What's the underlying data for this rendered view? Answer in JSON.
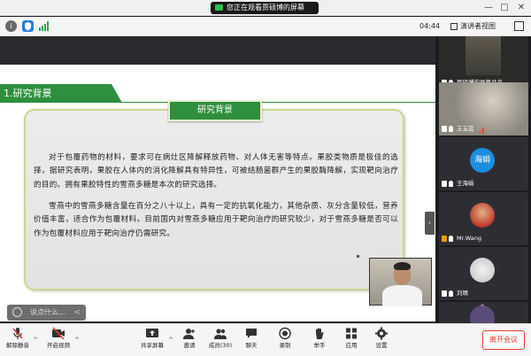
{
  "window": {
    "sharing_notice": "您正在观看贾硕博的屏幕",
    "controls": [
      "—",
      "□",
      "✕"
    ]
  },
  "infobar": {
    "info_icon": "i",
    "timer": "04:44",
    "view_label": "演讲者视图"
  },
  "slide": {
    "section_title": "1.研究背景",
    "box_title": "研究背景",
    "paragraphs": [
      "对于包覆药物的材料，要求可在病灶区降解释放药物、对人体无害等特点。果胶类物质是极佳的选择，据研究表明，果胶在人体内的消化降解具有特异性，可被结肠菌群产生的果胶酶降解，实现靶向治疗的目的。拥有果胶特性的雪燕多糖是本次的研究选择。",
      "雪燕中的雪燕多糖含量在百分之八十以上，具有一定的抗氧化能力，其他杂质、灰分含量较低，营养价值丰富，适合作为包覆材料。目前国内对雪燕多糖应用于靶向治疗的研究较少，对于雪燕多糖是否可以作为包覆材料应用于靶向治疗仍需研究。"
    ]
  },
  "chat": {
    "placeholder": "说点什么...",
    "chevron": "<"
  },
  "panel": {
    "participants": [
      {
        "name": "贾硕博的屏幕共享",
        "avatar_text": ""
      },
      {
        "name": "王玉蕊",
        "avatar_text": ""
      },
      {
        "name": "王海娟",
        "avatar_text": "海娟"
      },
      {
        "name": "Mr.Wang",
        "avatar_text": ""
      },
      {
        "name": "刘晴",
        "avatar_text": ""
      },
      {
        "name": "",
        "avatar_text": ""
      }
    ],
    "collapse_glyph": "›"
  },
  "toolbar": {
    "mute": "解除静音",
    "video": "开启视频",
    "share": "共享屏幕",
    "invite": "邀请",
    "members": "成员(30)",
    "chat": "聊天",
    "record": "录制",
    "raise_hand": "举手",
    "apps": "应用",
    "settings": "设置",
    "leave": "离开会议"
  },
  "colors": {
    "accent_green": "#2e8f3e",
    "leave_red": "#e03c31",
    "avatar_blue": "#1a8ee0"
  }
}
